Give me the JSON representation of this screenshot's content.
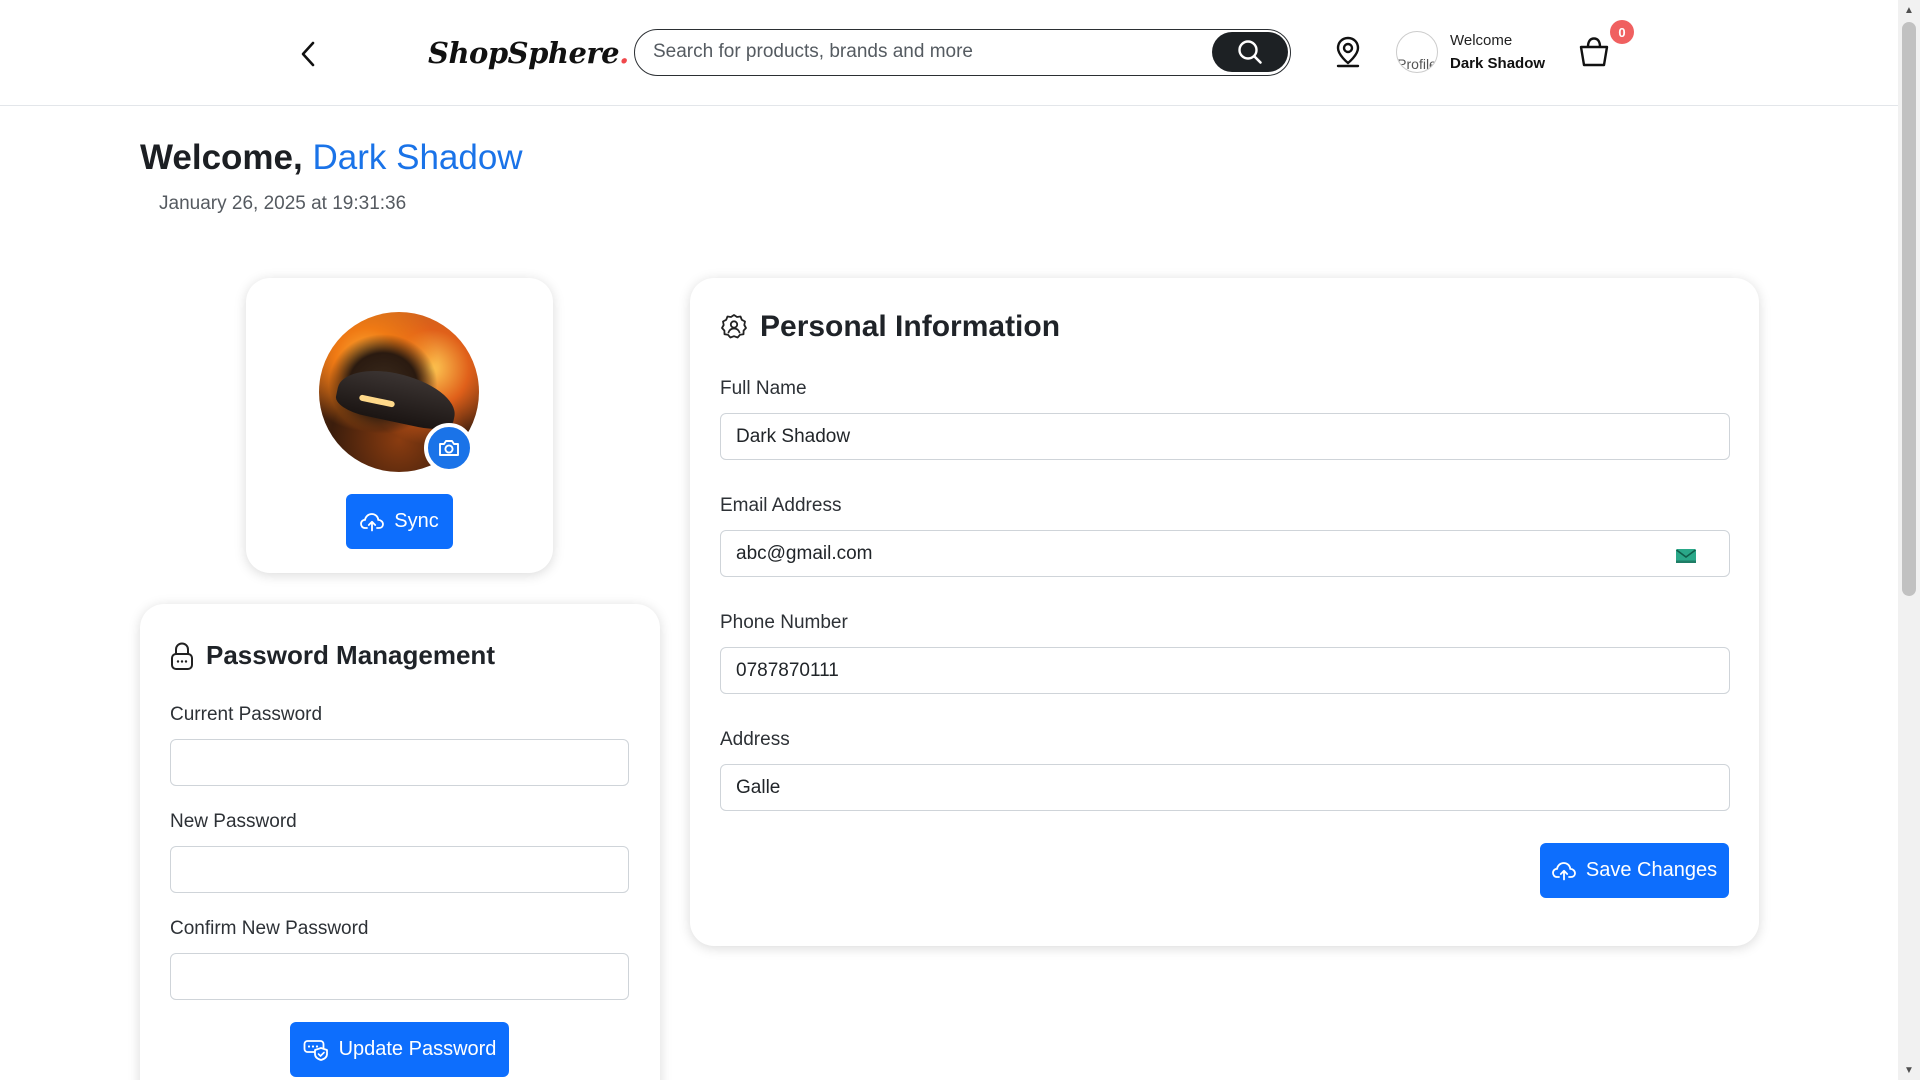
{
  "header": {
    "back_icon": "chevron-left-icon",
    "logo_text": "ShopSphere",
    "logo_dot": ".",
    "search": {
      "placeholder": "Search for products, brands and more",
      "value": ""
    },
    "search_icon": "search-icon",
    "location_icon": "location-pin-icon",
    "profile_img_alt": "Profile",
    "welcome_label": "Welcome",
    "user_name": "Dark Shadow",
    "cart_icon": "shopping-bag-icon",
    "cart_count": "0"
  },
  "welcome": {
    "greeting": "Welcome, ",
    "name": "Dark Shadow",
    "timestamp": "January 26, 2025 at 19:31:36"
  },
  "avatar_card": {
    "camera_icon": "camera-icon",
    "sync_label": "Sync",
    "sync_icon": "cloud-upload-icon"
  },
  "password": {
    "title": "Password Management",
    "title_icon": "lock-icon",
    "current_label": "Current Password",
    "current_value": "",
    "new_label": "New Password",
    "new_value": "",
    "confirm_label": "Confirm New Password",
    "confirm_value": "",
    "update_label": "Update Password",
    "update_icon": "password-shield-icon"
  },
  "personal": {
    "title": "Personal Information",
    "title_icon": "user-gear-icon",
    "fullname_label": "Full Name",
    "fullname_value": "Dark Shadow",
    "email_label": "Email Address",
    "email_value": "abc@gmail.com",
    "email_icon": "envelope-icon",
    "phone_label": "Phone Number",
    "phone_value": "0787870111",
    "address_label": "Address",
    "address_value": "Galle",
    "save_label": "Save Changes",
    "save_icon": "cloud-upload-icon"
  },
  "colors": {
    "primary": "#0d6efd",
    "accent_name": "#1a73e8",
    "badge": "#f06060",
    "logo_dot": "#f0484b",
    "search_button": "#1d2124"
  }
}
